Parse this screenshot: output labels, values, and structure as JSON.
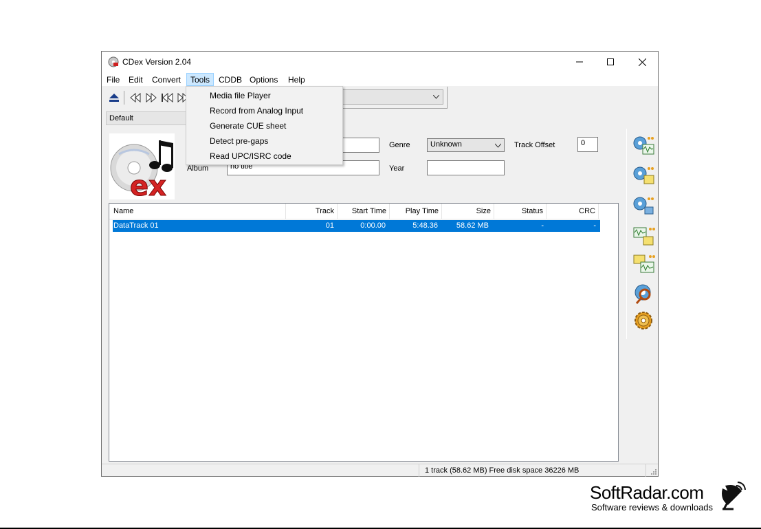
{
  "window": {
    "title": "CDex Version 2.04"
  },
  "menu": [
    "File",
    "Edit",
    "Convert",
    "Tools",
    "CDDB",
    "Options",
    "Help"
  ],
  "tools_menu": [
    "Media file Player",
    "Record from Analog Input",
    "Generate CUE sheet",
    "Detect pre-gaps",
    "Read UPC/ISRC code"
  ],
  "profile": "Default",
  "disc": {
    "album_label": "Album",
    "album_value": "no title",
    "genre_label": "Genre",
    "genre_value": "Unknown",
    "year_label": "Year",
    "year_value": "",
    "track_offset_label": "Track Offset",
    "track_offset_value": "0"
  },
  "track_list": {
    "columns": [
      "Name",
      "Track",
      "Start Time",
      "Play Time",
      "Size",
      "Status",
      "CRC"
    ],
    "rows": [
      {
        "name": "DataTrack 01",
        "track": "01",
        "start": "0:00.00",
        "play": "5:48.36",
        "size": "58.62 MB",
        "status": "-",
        "crc": "-"
      }
    ]
  },
  "status_bar": {
    "text": "1 track (58.62 MB) Free disk space 36226 MB"
  },
  "sidebar_buttons": [
    "cd-to-wav-icon",
    "cd-to-mp3-icon",
    "cd-to-encoded-icon",
    "wav-to-mp3-icon",
    "mp3-to-wav-icon",
    "read-cd-info-icon",
    "settings-icon"
  ],
  "watermark": {
    "title": "SoftRadar.com",
    "subtitle": "Software reviews & downloads"
  },
  "colors": {
    "selection": "#0078d7",
    "menu_highlight": "#cce8ff",
    "window_bg": "#f0f0f0"
  }
}
